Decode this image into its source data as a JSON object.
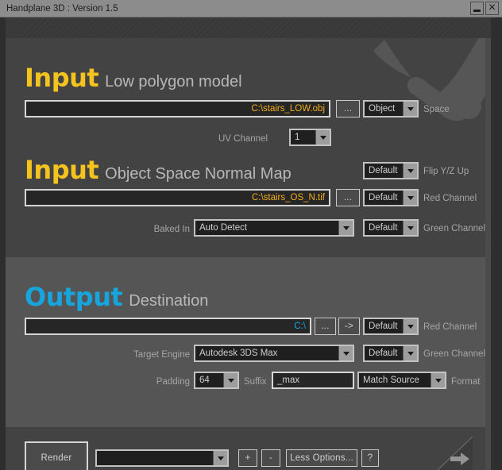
{
  "window": {
    "title": "Handplane 3D : Version 1.5",
    "minimize_label": "minimize",
    "close_label": "×"
  },
  "sections": {
    "input_low_poly": {
      "title": "Input",
      "subtitle": "Low polygon model",
      "path_field": {
        "value": "C:\\stairs_LOW.obj",
        "placeholder": ""
      },
      "browse_button": "...",
      "space_dropdown": {
        "value": "Object",
        "label": "Space"
      },
      "uv_channel": {
        "label": "UV Channel",
        "value": "1"
      }
    },
    "input_normal_map": {
      "title": "Input",
      "subtitle": "Object Space Normal Map",
      "flip_dropdown": {
        "value": "Default",
        "label": "Flip Y/Z Up"
      },
      "path_field": {
        "value": "C:\\stairs_OS_N.tif",
        "placeholder": ""
      },
      "browse_button": "...",
      "red_channel": {
        "value": "Default",
        "label": "Red Channel"
      },
      "baked_in": {
        "label": "Baked In",
        "value": "Auto Detect"
      },
      "green_channel": {
        "value": "Default",
        "label": "Green Channel"
      }
    },
    "output": {
      "title": "Output",
      "subtitle": "Destination",
      "path_field": {
        "value": "C:\\",
        "placeholder": ""
      },
      "browse_button": "...",
      "goto_button": "->",
      "red_channel": {
        "value": "Default",
        "label": "Red Channel"
      },
      "target_engine": {
        "label": "Target Engine",
        "value": "Autodesk 3DS Max"
      },
      "green_channel": {
        "value": "Default",
        "label": "Green Channel"
      },
      "padding": {
        "label": "Padding",
        "value": "64"
      },
      "suffix": {
        "label": "Suffix",
        "value": "_max"
      },
      "format": {
        "value": "Match Source",
        "label": "Format"
      }
    }
  },
  "footer": {
    "render_button": "Render",
    "preset_dropdown": {
      "value": ""
    },
    "add_button": "+",
    "remove_button": "-",
    "less_options_button": "Less Options...",
    "help_button": "?"
  },
  "colors": {
    "accent_yellow": "#f4c31d",
    "accent_blue": "#16a5dc",
    "path_amber": "#f0ad1e",
    "titlebar": "#8c8c8c",
    "panel": "#4b4b4b"
  }
}
